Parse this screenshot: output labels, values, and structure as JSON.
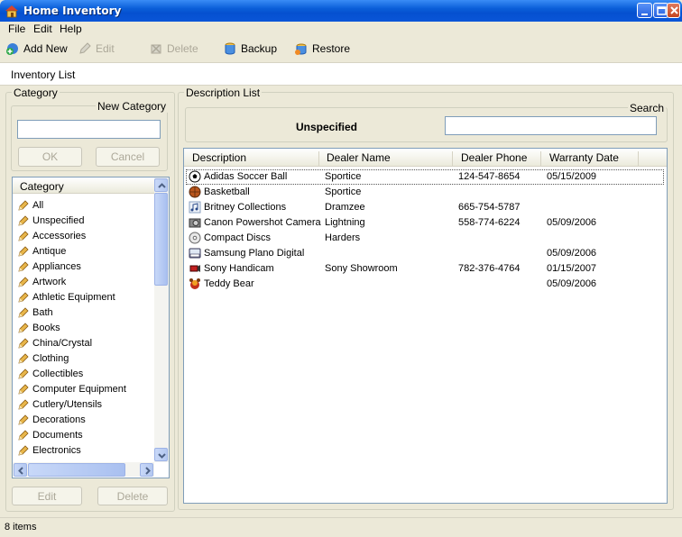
{
  "window": {
    "title": "Home Inventory"
  },
  "menu": [
    "File",
    "Edit",
    "Help"
  ],
  "toolbar": {
    "add_new": "Add New",
    "edit": "Edit",
    "delete": "Delete",
    "backup": "Backup",
    "restore": "Restore"
  },
  "section_label": "Inventory List",
  "category_panel": {
    "group_title": "Category",
    "new_category_title": "New Category",
    "new_category_value": "",
    "ok_label": "OK",
    "cancel_label": "Cancel",
    "list_header": "Category",
    "items": [
      "All",
      "Unspecified",
      "Accessories",
      "Antique",
      "Appliances",
      "Artwork",
      "Athletic Equipment",
      "Bath",
      "Books",
      "China/Crystal",
      "Clothing",
      "Collectibles",
      "Computer Equipment",
      "Cutlery/Utensils",
      "Decorations",
      "Documents",
      "Electronics"
    ],
    "edit_label": "Edit",
    "delete_label": "Delete"
  },
  "description_panel": {
    "group_title": "Description List",
    "search_title": "Search",
    "search_value": "",
    "current_category": "Unspecified",
    "columns": [
      "Description",
      "Dealer Name",
      "Dealer Phone",
      "Warranty Date"
    ],
    "rows": [
      {
        "icon": "soccer-ball-icon",
        "description": "Adidas Soccer Ball",
        "dealer": "Sportice",
        "phone": "124-547-8654",
        "warranty": "05/15/2009"
      },
      {
        "icon": "basketball-icon",
        "description": "Basketball",
        "dealer": "Sportice",
        "phone": "",
        "warranty": ""
      },
      {
        "icon": "music-note-icon",
        "description": "Britney Collections",
        "dealer": "Dramzee",
        "phone": "665-754-5787",
        "warranty": ""
      },
      {
        "icon": "camera-icon",
        "description": "Canon Powershot Camera",
        "dealer": "Lightning",
        "phone": "558-774-6224",
        "warranty": "05/09/2006"
      },
      {
        "icon": "disc-icon",
        "description": "Compact Discs",
        "dealer": "Harders",
        "phone": "",
        "warranty": ""
      },
      {
        "icon": "piano-icon",
        "description": "Samsung Plano Digital",
        "dealer": "",
        "phone": "",
        "warranty": "05/09/2006"
      },
      {
        "icon": "handicam-icon",
        "description": "Sony Handicam",
        "dealer": "Sony Showroom",
        "phone": "782-376-4764",
        "warranty": "01/15/2007"
      },
      {
        "icon": "teddy-bear-icon",
        "description": "Teddy Bear",
        "dealer": "",
        "phone": "",
        "warranty": "05/09/2006"
      }
    ]
  },
  "status": "8 items"
}
